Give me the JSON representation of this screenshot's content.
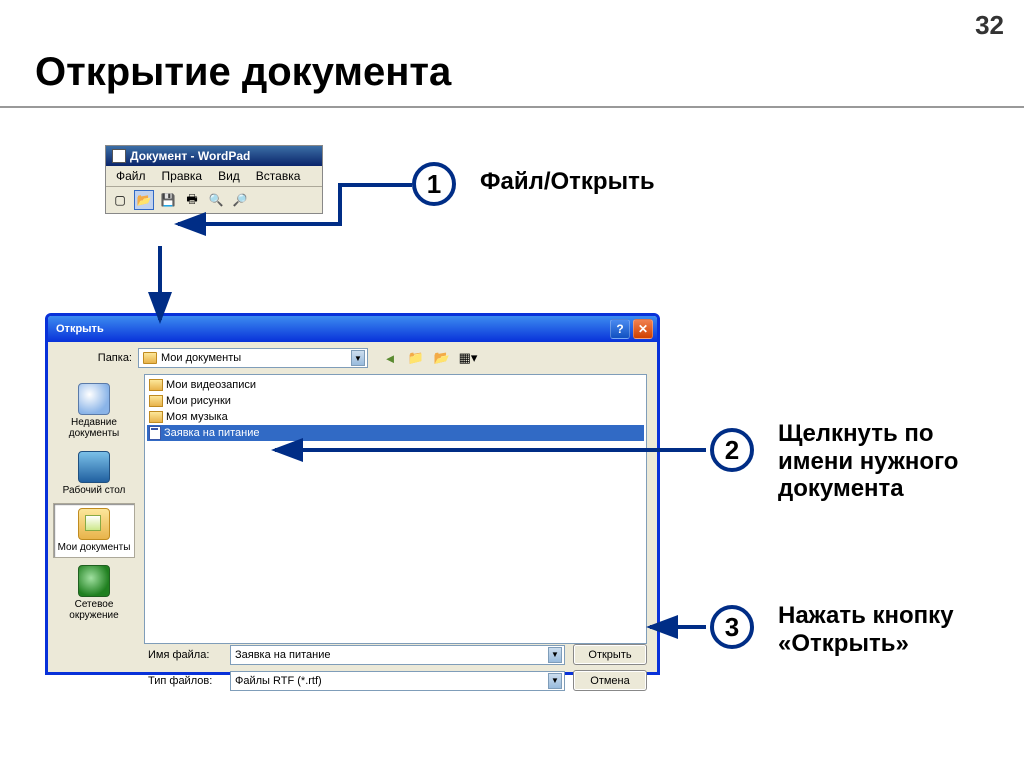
{
  "page_number": "32",
  "slide_title": "Открытие документа",
  "wordpad": {
    "title": "Документ - WordPad",
    "menu": [
      "Файл",
      "Правка",
      "Вид",
      "Вставка"
    ]
  },
  "open_dialog": {
    "title": "Открыть",
    "folder_label": "Папка:",
    "folder_value": "Мои документы",
    "sidebar": [
      {
        "label": "Недавние документы"
      },
      {
        "label": "Рабочий стол"
      },
      {
        "label": "Мои документы"
      },
      {
        "label": "Сетевое окружение"
      }
    ],
    "files": [
      {
        "name": "Мои видеозаписи",
        "type": "folder"
      },
      {
        "name": "Мои рисунки",
        "type": "folder"
      },
      {
        "name": "Моя музыка",
        "type": "folder"
      },
      {
        "name": "Заявка на питание",
        "type": "doc",
        "selected": true
      }
    ],
    "filename_label": "Имя файла:",
    "filename_value": "Заявка на питание",
    "filetype_label": "Тип файлов:",
    "filetype_value": "Файлы RTF (*.rtf)",
    "open_btn": "Открыть",
    "cancel_btn": "Отмена"
  },
  "annotations": {
    "b1": "1",
    "t1": "Файл/Открыть",
    "b2": "2",
    "t2": "Щелкнуть по имени нужного документа",
    "b3": "3",
    "t3": "Нажать кнопку «Открыть»"
  }
}
